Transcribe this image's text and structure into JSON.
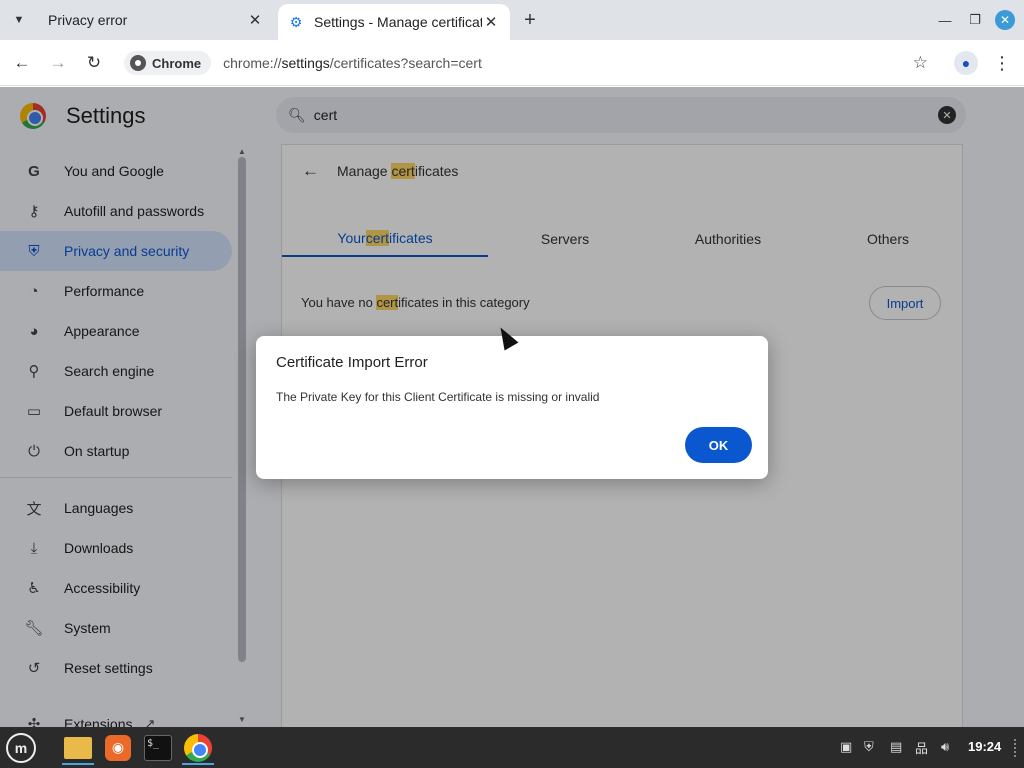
{
  "tabs": [
    {
      "title": "Privacy error"
    },
    {
      "title": "Settings - Manage certificates"
    }
  ],
  "toolbar": {
    "chip_label": "Chrome",
    "url_prefix": "chrome://",
    "url_host": "settings",
    "url_rest": "/certificates?search=cert"
  },
  "settings": {
    "title": "Settings",
    "search_value": "cert",
    "nav": [
      {
        "label": "You and Google",
        "icon": "google-icon"
      },
      {
        "label": "Autofill and passwords",
        "icon": "key-icon"
      },
      {
        "label": "Privacy and security",
        "icon": "shield-icon"
      },
      {
        "label": "Performance",
        "icon": "speedometer-icon"
      },
      {
        "label": "Appearance",
        "icon": "palette-icon"
      },
      {
        "label": "Search engine",
        "icon": "search-icon"
      },
      {
        "label": "Default browser",
        "icon": "browser-icon"
      },
      {
        "label": "On startup",
        "icon": "power-icon"
      },
      {
        "label": "Languages",
        "icon": "translate-icon"
      },
      {
        "label": "Downloads",
        "icon": "download-icon"
      },
      {
        "label": "Accessibility",
        "icon": "accessibility-icon"
      },
      {
        "label": "System",
        "icon": "wrench-icon"
      },
      {
        "label": "Reset settings",
        "icon": "reset-icon"
      },
      {
        "label": "Extensions",
        "icon": "puzzle-icon"
      }
    ],
    "selected_nav": "Privacy and security"
  },
  "certs": {
    "heading_pre": "Manage ",
    "heading_mark": "cert",
    "heading_post": "ificates",
    "tabs": [
      {
        "pre": "Your ",
        "mark": "cert",
        "post": "ificates"
      },
      {
        "label": "Servers"
      },
      {
        "label": "Authorities"
      },
      {
        "label": "Others"
      }
    ],
    "empty_pre": "You have no ",
    "empty_mark": "cert",
    "empty_post": "ificates in this category",
    "import_label": "Import"
  },
  "dialog": {
    "title": "Certificate Import Error",
    "message": "The Private Key for this Client Certificate is missing or invalid",
    "ok_label": "OK"
  },
  "taskbar": {
    "clock": "19:24"
  },
  "colors": {
    "accent": "#0b57d0",
    "highlight": "#fdd663"
  }
}
